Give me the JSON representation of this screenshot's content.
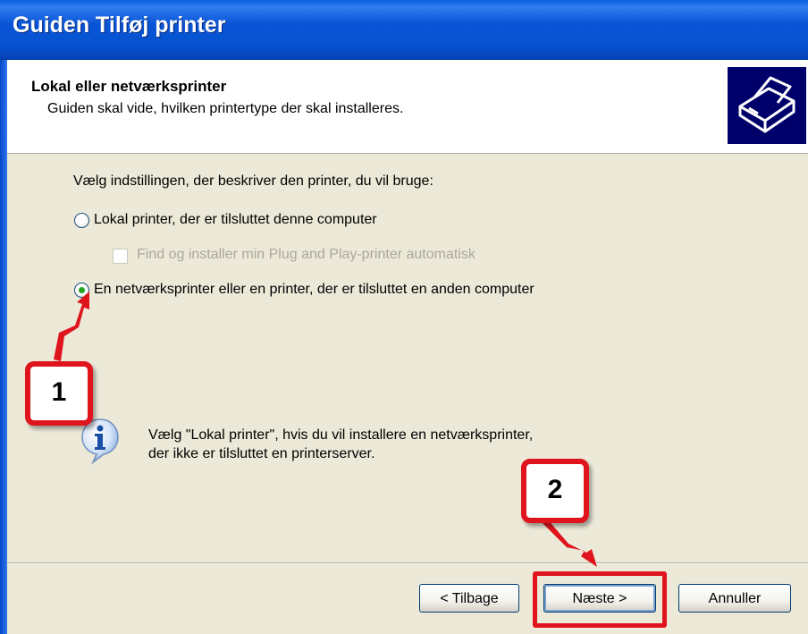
{
  "window": {
    "title": "Guiden Tilføj printer"
  },
  "header": {
    "title": "Lokal eller netværksprinter",
    "subtitle": "Guiden skal vide, hvilken printertype der skal installeres.",
    "icon": "printer-icon"
  },
  "content": {
    "prompt": "Vælg indstillingen, der beskriver den printer, du vil bruge:",
    "options": [
      {
        "label": "Lokal printer, der er tilsluttet denne computer",
        "selected": false
      },
      {
        "label": "En netværksprinter eller en printer, der er tilsluttet en anden computer",
        "selected": true
      }
    ],
    "checkbox": {
      "label": "Find og installer min Plug and Play-printer automatisk",
      "checked": false,
      "enabled": false
    },
    "info": {
      "icon": "info-icon",
      "line1": "Vælg \"Lokal printer\", hvis du vil installere en netværksprinter,",
      "line2": "der ikke er tilsluttet en printerserver."
    }
  },
  "buttons": {
    "back": "< Tilbage",
    "next": "Næste >",
    "cancel": "Annuller"
  },
  "annotations": {
    "callout1": "1",
    "callout2": "2",
    "color": "#E0141D"
  }
}
